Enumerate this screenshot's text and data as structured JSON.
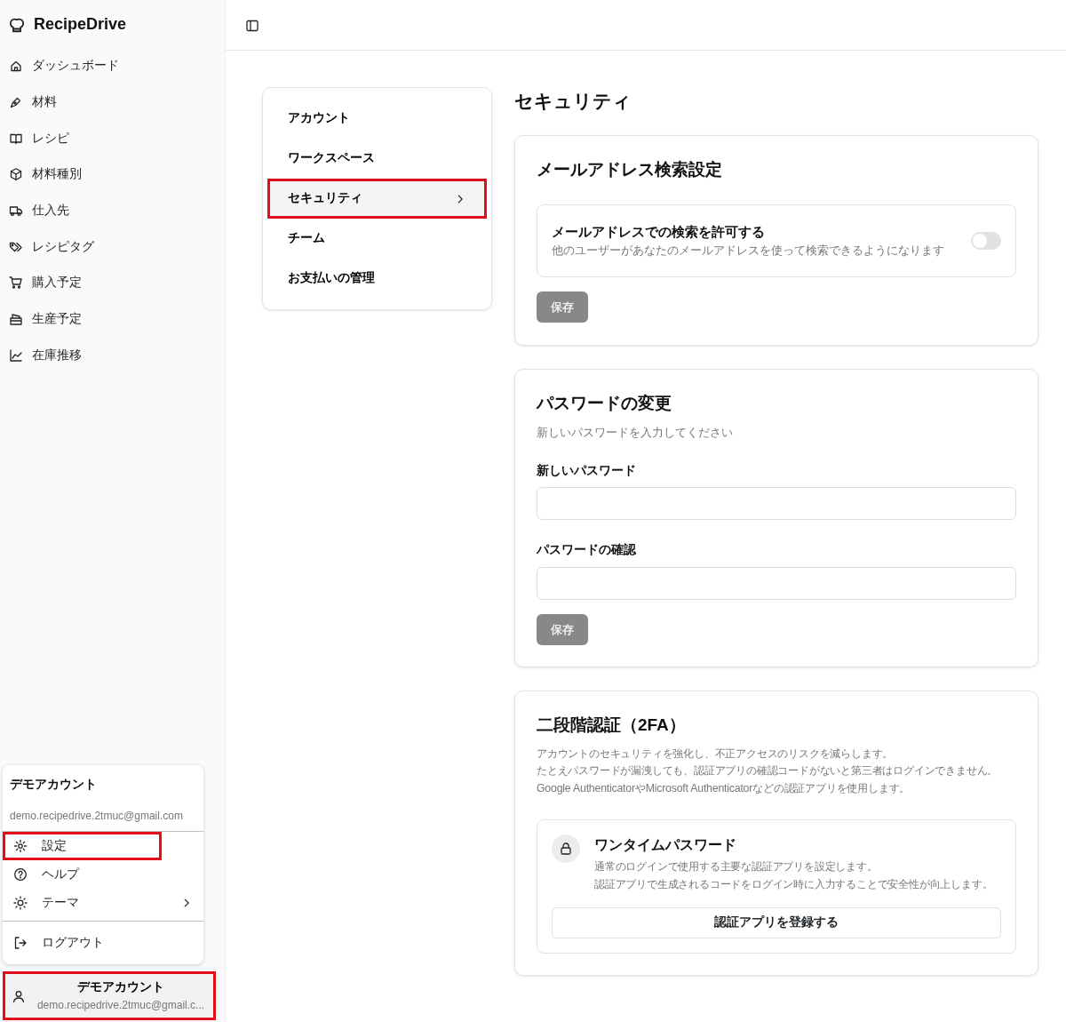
{
  "sidebar": {
    "brand": "RecipeDrive",
    "items": [
      {
        "label": "ダッシュボード"
      },
      {
        "label": "材料"
      },
      {
        "label": "レシピ"
      },
      {
        "label": "材料種別"
      },
      {
        "label": "仕入先"
      },
      {
        "label": "レシピタグ"
      },
      {
        "label": "購入予定"
      },
      {
        "label": "生産予定"
      },
      {
        "label": "在庫推移"
      }
    ],
    "user_menu": {
      "name": "デモアカウント",
      "email": "demo.recipedrive.2tmuc@gmail.com",
      "items": [
        {
          "label": "設定",
          "highlighted": true,
          "submenu": false,
          "separated": false
        },
        {
          "label": "ヘルプ",
          "highlighted": false,
          "submenu": false,
          "separated": false
        },
        {
          "label": "テーマ",
          "highlighted": false,
          "submenu": true,
          "separated": false
        },
        {
          "label": "ログアウト",
          "highlighted": false,
          "submenu": false,
          "separated": true
        }
      ]
    },
    "account": {
      "name": "デモアカウント",
      "email": "demo.recipedrive.2tmuc@gmail.c...",
      "highlighted": true
    }
  },
  "settings_nav": [
    {
      "label": "アカウント",
      "selected": false,
      "highlighted": false
    },
    {
      "label": "ワークスペース",
      "selected": false,
      "highlighted": false
    },
    {
      "label": "セキュリティ",
      "selected": true,
      "highlighted": true
    },
    {
      "label": "チーム",
      "selected": false,
      "highlighted": false
    },
    {
      "label": "お支払いの管理",
      "selected": false,
      "highlighted": false
    }
  ],
  "page_title": "セキュリティ",
  "email_search": {
    "title": "メールアドレス検索設定",
    "option_label": "メールアドレスでの検索を許可する",
    "option_description": "他のユーザーがあなたのメールアドレスを使って検索できるようになります",
    "on": false,
    "save": {
      "label": "保存",
      "disabled": true
    }
  },
  "password": {
    "title": "パスワードの変更",
    "subtitle": "新しいパスワードを入力してください",
    "fields": [
      {
        "label": "新しいパスワード"
      },
      {
        "label": "パスワードの確認"
      }
    ],
    "save": {
      "label": "保存",
      "disabled": true
    }
  },
  "two_factor": {
    "title": "二段階認証（2FA）",
    "description_lines": [
      "アカウントのセキュリティを強化し、不正アクセスのリスクを減らします。",
      "たとえパスワードが漏洩しても、認証アプリの確認コードがないと第三者はログインできません。",
      "Google AuthenticatorやMicrosoft Authenticatorなどの認証アプリを使用します。"
    ],
    "otp": {
      "title": "ワンタイムパスワード",
      "description_lines": [
        "通常のログインで使用する主要な認証アプリを設定します。",
        "認証アプリで生成されるコードをログイン時に入力することで安全性が向上します。"
      ],
      "button": "認証アプリを登録する"
    }
  }
}
